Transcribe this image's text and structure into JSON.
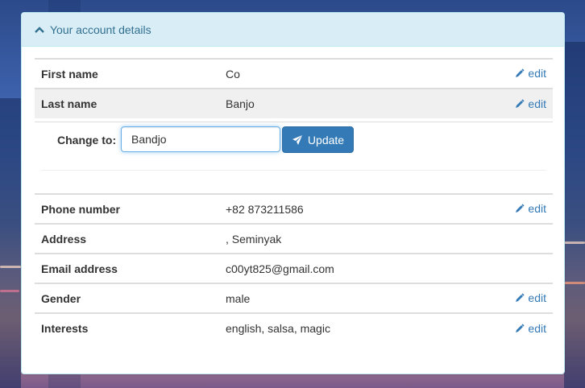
{
  "panel": {
    "title": "Your account details"
  },
  "rows_top": [
    {
      "label": "First name",
      "value": "Co",
      "edit": "edit"
    },
    {
      "label": "Last name",
      "value": "Banjo",
      "edit": "edit"
    }
  ],
  "change": {
    "label": "Change to:",
    "value": "Bandjo",
    "button": "Update"
  },
  "rows_bottom": [
    {
      "label": "Phone number",
      "value": "+82 873211586",
      "edit": "edit"
    },
    {
      "label": "Address",
      "value": ", Seminyak",
      "edit": ""
    },
    {
      "label": "Email address",
      "value": "c00yt825@gmail.com",
      "edit": ""
    },
    {
      "label": "Gender",
      "value": "male",
      "edit": "edit"
    },
    {
      "label": "Interests",
      "value": "english, salsa, magic",
      "edit": "edit"
    }
  ],
  "icons": {
    "collapse": "chevron-up-icon",
    "edit": "pencil-icon",
    "update": "paper-plane-icon"
  },
  "colors": {
    "accent": "#337ab7",
    "heading_bg": "#d9edf7",
    "heading_text": "#31708f"
  }
}
